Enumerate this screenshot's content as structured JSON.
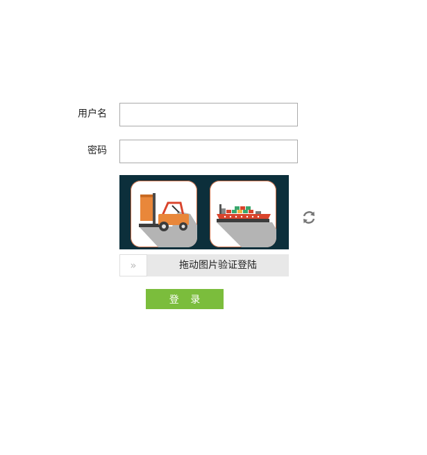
{
  "form": {
    "username_label": "用户名",
    "username_value": "",
    "password_label": "密码",
    "password_value": "",
    "captcha": {
      "tiles": [
        "forklift-image",
        "cargo-ship-image"
      ],
      "refresh_icon": "refresh-icon",
      "slider_handle_icon": "double-chevron-right-icon",
      "slider_handle_glyph": "»",
      "slider_text": "拖动图片验证登陆"
    },
    "login_label": "登 录"
  },
  "colors": {
    "captcha_bg": "#0c2f3b",
    "login_button": "#7bbd3c",
    "input_border": "#a9a9a9",
    "slider_track": "#e8e8e8"
  }
}
